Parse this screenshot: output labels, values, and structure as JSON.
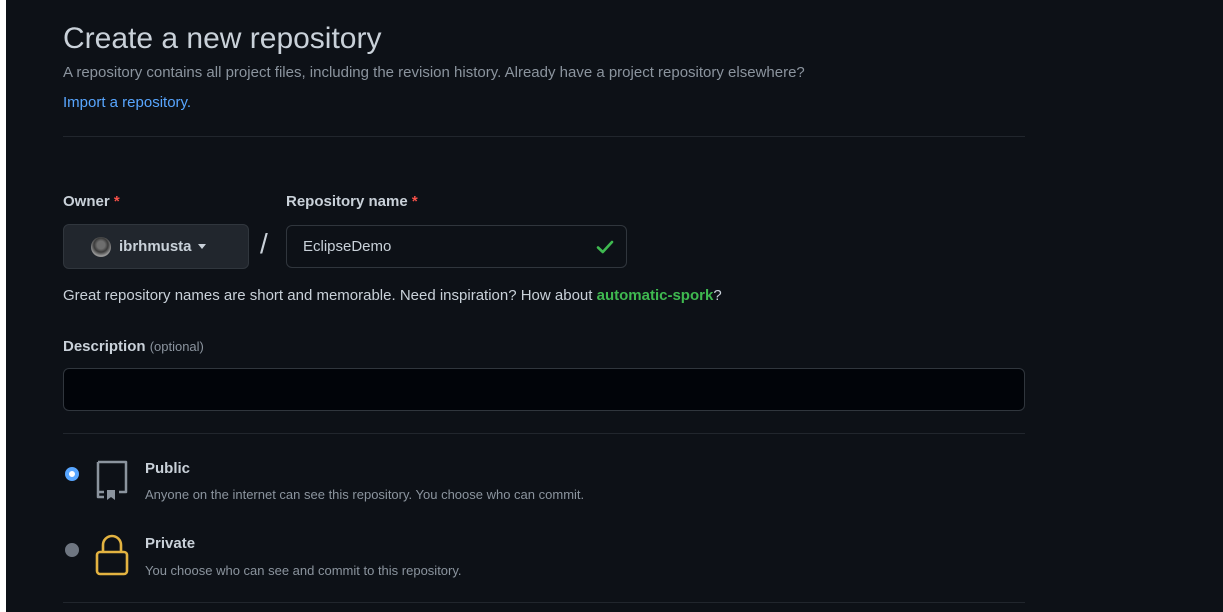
{
  "header": {
    "title": "Create a new repository",
    "subtitle": "A repository contains all project files, including the revision history. Already have a project repository elsewhere?",
    "import_link": "Import a repository."
  },
  "owner": {
    "label": "Owner",
    "required_mark": "*",
    "selected": "ibrhmusta"
  },
  "repo": {
    "label": "Repository name",
    "required_mark": "*",
    "value": "EclipseDemo",
    "separator": "/"
  },
  "hint": {
    "text": "Great repository names are short and memorable. Need inspiration? How about ",
    "suggestion": "automatic-spork",
    "end": "?"
  },
  "description": {
    "label": "Description",
    "optional": "(optional)",
    "value": ""
  },
  "visibility": {
    "options": [
      {
        "title": "Public",
        "desc": "Anyone on the internet can see this repository. You choose who can commit.",
        "selected": true
      },
      {
        "title": "Private",
        "desc": "You choose who can see and commit to this repository.",
        "selected": false
      }
    ]
  },
  "colors": {
    "background": "#0d1117",
    "link": "#58a6ff",
    "success": "#3fb950",
    "required": "#f85149",
    "lock": "#e3b341"
  },
  "icons": {
    "owner_avatar": "avatar",
    "owner_caret": "caret-down-icon",
    "repo_valid": "check-icon",
    "public": "repo-icon",
    "private": "lock-icon"
  }
}
